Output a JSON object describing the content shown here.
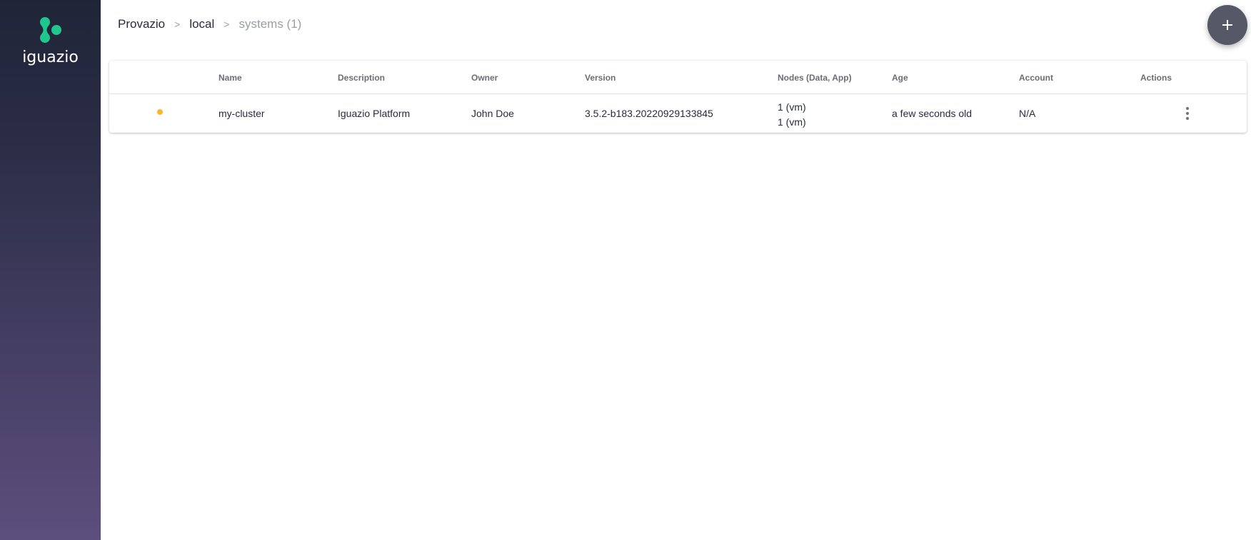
{
  "brand": {
    "name": "iguazio",
    "logo_icon": "iguazio-logo-icon",
    "logo_color": "#1fc78f"
  },
  "breadcrumb": {
    "items": [
      "Provazio",
      "local",
      "systems (1)"
    ],
    "separator": ">"
  },
  "fab": {
    "icon": "plus-icon",
    "label": "+"
  },
  "table": {
    "columns": [
      "",
      "Name",
      "Description",
      "Owner",
      "Version",
      "Nodes (Data, App)",
      "Age",
      "Account",
      "Actions"
    ],
    "rows": [
      {
        "status_color": "#f8b72d",
        "name": "my-cluster",
        "description": "Iguazio Platform",
        "owner": "John Doe",
        "version": "3.5.2-b183.20220929133845",
        "nodes_data": "1 (vm)",
        "nodes_app": "1 (vm)",
        "age": "a few seconds old",
        "account": "N/A",
        "actions_icon": "more-vertical-icon"
      }
    ]
  }
}
